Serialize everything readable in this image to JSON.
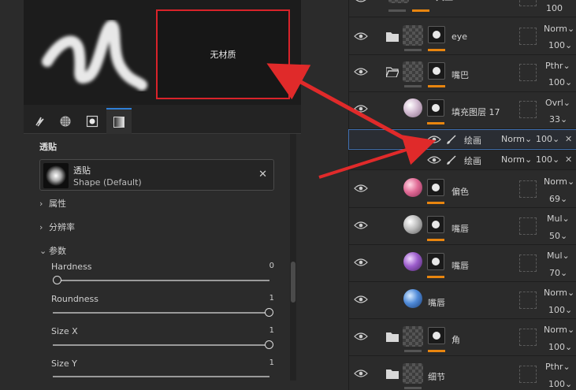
{
  "preview": {
    "no_material_label": "无材质"
  },
  "tabs": [
    {
      "icon": "brush-stroke-icon"
    },
    {
      "icon": "material-sphere-icon"
    },
    {
      "icon": "mask-icon"
    },
    {
      "icon": "gradient-icon"
    }
  ],
  "properties": {
    "section_title": "透贴",
    "decal": {
      "name": "透贴",
      "subtitle": "Shape (Default)"
    },
    "groups": [
      "属性",
      "分辨率",
      "参数"
    ],
    "params": [
      {
        "label": "Hardness",
        "value": "0",
        "fraction": 0.0
      },
      {
        "label": "Roundness",
        "value": "1",
        "fraction": 1.0
      },
      {
        "label": "Size X",
        "value": "1",
        "fraction": 1.0
      },
      {
        "label": "Size Y",
        "value": "1",
        "fraction": 1.0
      }
    ]
  },
  "layers": [
    {
      "name": "大血",
      "blend": "",
      "opacity": "100"
    },
    {
      "name": "eye",
      "blend": "Norm",
      "opacity": "100"
    },
    {
      "name": "嘴巴",
      "blend": "Pthr",
      "opacity": "100"
    },
    {
      "name": "填充图层 17",
      "blend": "Ovrl",
      "opacity": "33"
    },
    {
      "name": "绘画",
      "blend": "Norm",
      "opacity": "100"
    },
    {
      "name": "绘画",
      "blend": "Norm",
      "opacity": "100"
    },
    {
      "name": "偏色",
      "blend": "Norm",
      "opacity": "69"
    },
    {
      "name": "嘴唇",
      "blend": "Mul",
      "opacity": "50"
    },
    {
      "name": "嘴唇",
      "blend": "Mul",
      "opacity": "70"
    },
    {
      "name": "嘴唇",
      "blend": "Norm",
      "opacity": "100"
    },
    {
      "name": "角",
      "blend": "Norm",
      "opacity": "100"
    },
    {
      "name": "细节",
      "blend": "Pthr",
      "opacity": "100"
    }
  ],
  "colors": {
    "accent": "#2f7fd6",
    "annotation": "#d9232a",
    "mask_bar": "#e8850f"
  }
}
